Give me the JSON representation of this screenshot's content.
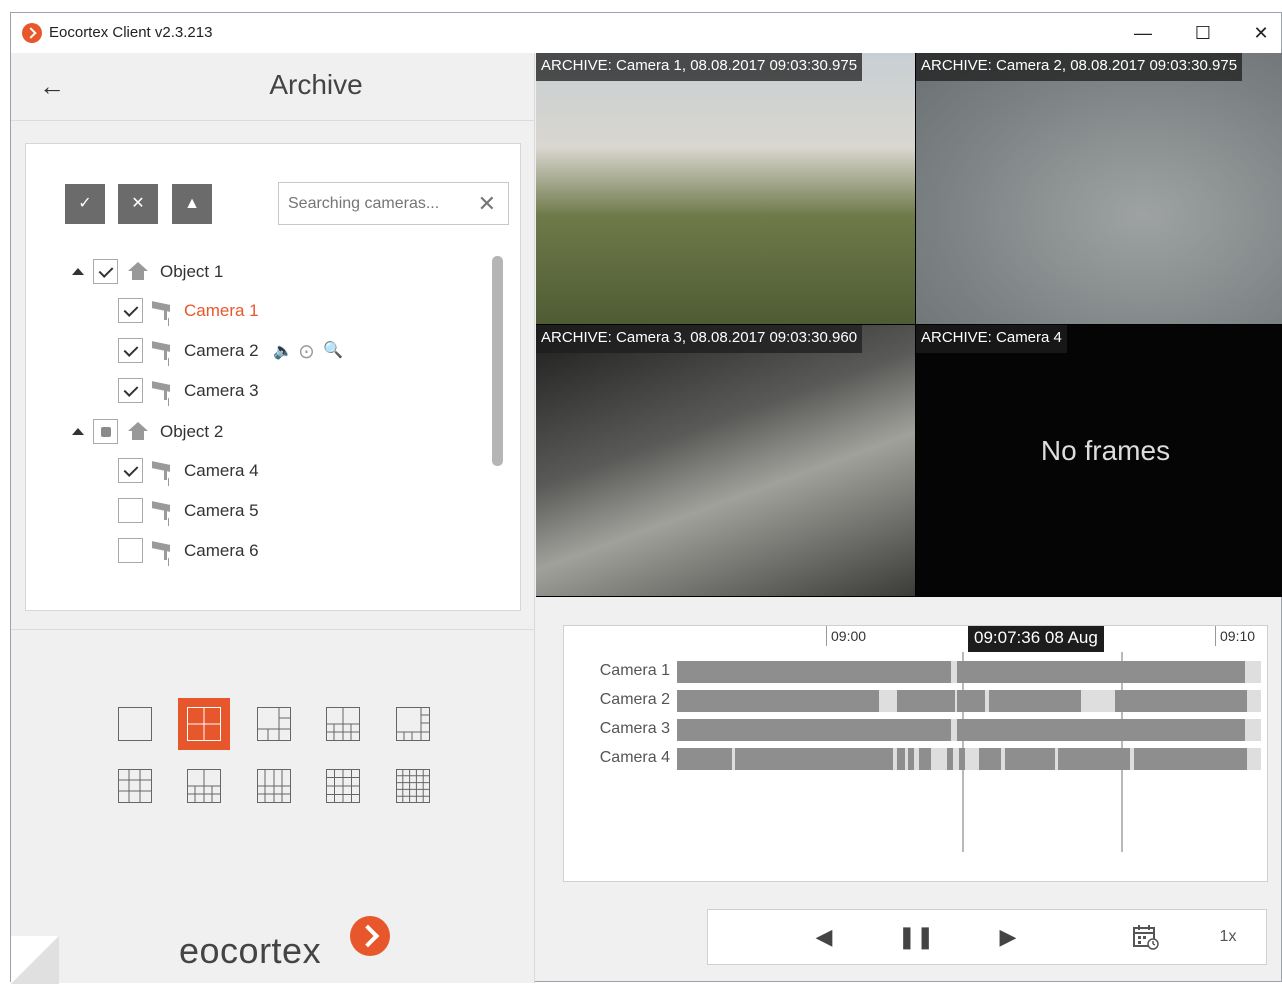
{
  "window": {
    "title": "Eocortex Client v2.3.213",
    "minimize": "—",
    "maximize": "☐",
    "close": "✕"
  },
  "header": {
    "back_icon": "←",
    "title": "Archive"
  },
  "toolbar": {
    "check_all": "✓",
    "uncheck_all": "✕",
    "collapse": "▲"
  },
  "search": {
    "placeholder": "Searching cameras...",
    "clear": "✕"
  },
  "tree": {
    "object1": {
      "label": "Object 1"
    },
    "object2": {
      "label": "Object 2"
    },
    "cameras": [
      {
        "label": "Camera 1"
      },
      {
        "label": "Camera 2"
      },
      {
        "label": "Camera 3"
      },
      {
        "label": "Camera 4"
      },
      {
        "label": "Camera 5"
      },
      {
        "label": "Camera 6"
      }
    ],
    "camera2_icons": {
      "sound": "🔈",
      "ptz": "⊙",
      "zoom": "🔍"
    }
  },
  "videos": [
    {
      "label": "ARCHIVE: Camera 1, 08.08.2017 09:03:30.975"
    },
    {
      "label": "ARCHIVE: Camera 2, 08.08.2017 09:03:30.975"
    },
    {
      "label": "ARCHIVE: Camera 3, 08.08.2017 09:03:30.960"
    },
    {
      "label": "ARCHIVE: Camera 4",
      "message": "No frames"
    }
  ],
  "timeline": {
    "ticks": [
      "09:00",
      "09:10"
    ],
    "cursor_label": "09:07:36 08 Aug",
    "tracks": [
      {
        "label": "Camera 1"
      },
      {
        "label": "Camera 2"
      },
      {
        "label": "Camera 3"
      },
      {
        "label": "Camera 4"
      }
    ]
  },
  "playback": {
    "prev": "◀",
    "pause": "❚❚",
    "next": "▶",
    "calendar_icon": "calendar-clock-icon",
    "speed": "1x"
  },
  "brand": {
    "name": "eocortex"
  },
  "colors": {
    "accent": "#e8572b",
    "button_gray": "#6b6b6b",
    "track_gray": "#8e8e8e"
  }
}
